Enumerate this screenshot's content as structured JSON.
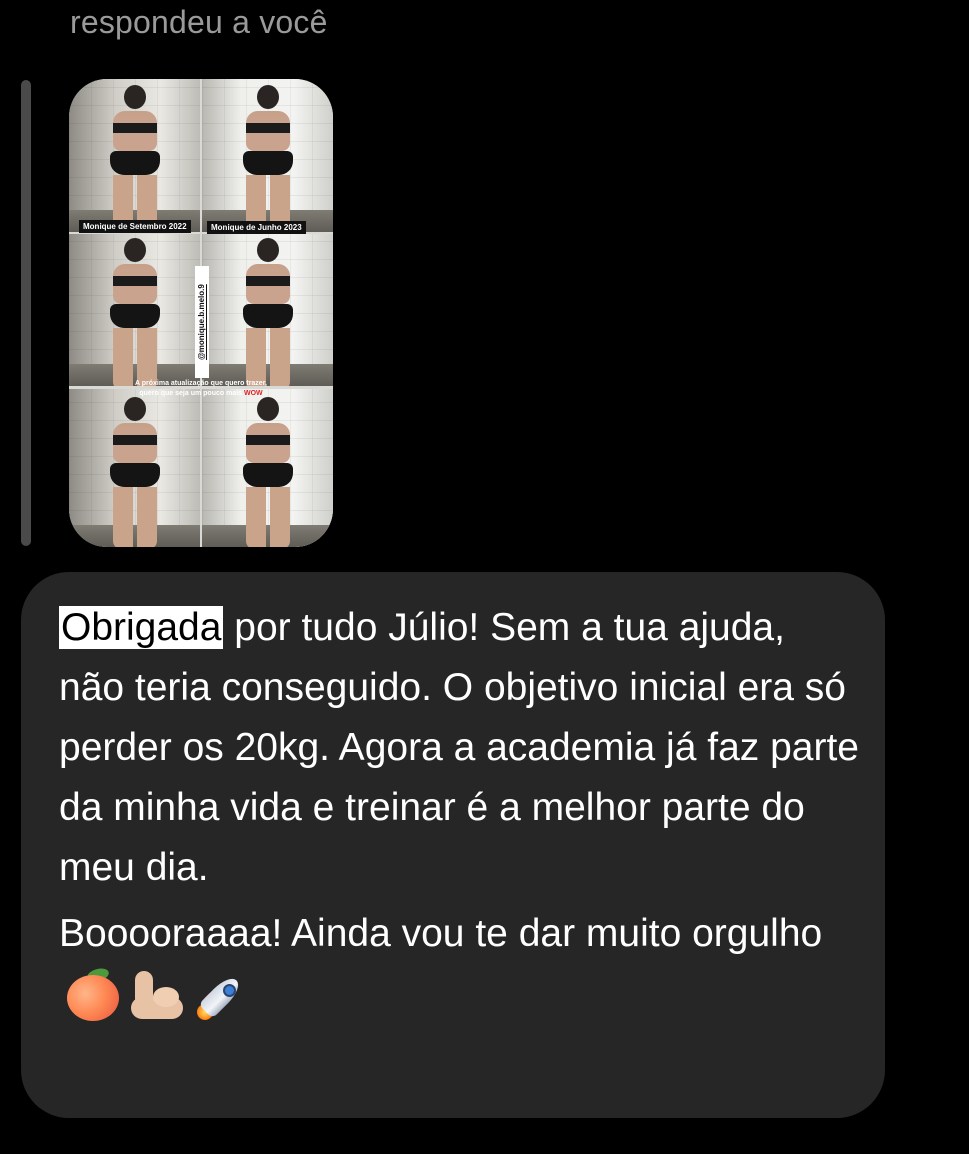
{
  "reply_header": "respondeu a você",
  "story": {
    "label_before": "Monique de Setembro 2022",
    "label_after": "Monique de Junho 2023",
    "handle": "@monique.b.melo.9",
    "caption_line1": "A próxima atualização que quero trazer,",
    "caption_line2_prefix": "quero que seja um pouco mais ",
    "caption_line2_highlight": "WOW"
  },
  "message": {
    "highlighted_word": "Obrigada",
    "paragraph1_rest": " por tudo Júlio! Sem a tua ajuda, não teria conseguido. O objetivo inicial era só perder os 20kg. Agora a academia já faz parte da minha vida e treinar é a melhor parte do meu dia.",
    "paragraph2_text": "Booooraaaa! Ainda vou te dar muito orgulho",
    "emojis": [
      "peach-emoji",
      "flexed-biceps-emoji",
      "rocket-emoji"
    ]
  },
  "colors": {
    "background": "#000000",
    "bubble": "#262626",
    "header_text": "#9a9a9a",
    "message_text": "#ffffff",
    "highlight": "#ffffff",
    "wow": "#e02424"
  }
}
